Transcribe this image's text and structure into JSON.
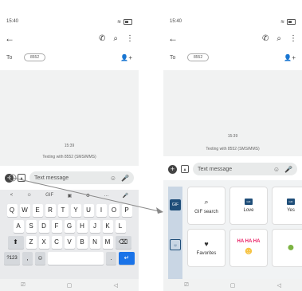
{
  "status": {
    "time": "15:40"
  },
  "appbar": {
    "back": "←",
    "call": "✆",
    "search": "⌕",
    "menu": "⋮"
  },
  "recipient": {
    "to_label": "To",
    "number": "8552"
  },
  "thread": {
    "time": "15:39",
    "texting": "Texting with 8552 (SMS/MMS)"
  },
  "compose": {
    "placeholder": "Text message"
  },
  "keyboard": {
    "toolbar": [
      "<",
      "☺",
      "GIF",
      "▣",
      "⚙",
      "…",
      "🎤"
    ],
    "row1": [
      "Q",
      "W",
      "E",
      "R",
      "T",
      "Y",
      "U",
      "I",
      "O",
      "P"
    ],
    "row1_hints": [
      "1",
      "2",
      "3",
      "4",
      "5",
      "6",
      "7",
      "8",
      "9",
      "0"
    ],
    "row2": [
      "A",
      "S",
      "D",
      "F",
      "G",
      "H",
      "J",
      "K",
      "L"
    ],
    "row3": [
      "Z",
      "X",
      "C",
      "V",
      "B",
      "N",
      "M"
    ],
    "bottom": {
      "sym": "?123",
      "comma": ",",
      "emoji": "☺",
      "period": ".",
      "enter": "↵"
    }
  },
  "stickers": {
    "gif_search": "GIF search",
    "love": "Love",
    "yes": "Yes",
    "favorites": "Favorites",
    "ha_text": "HA HA HA"
  },
  "nav": {
    "recent": "⎚",
    "home": "▢",
    "back": "◁"
  }
}
